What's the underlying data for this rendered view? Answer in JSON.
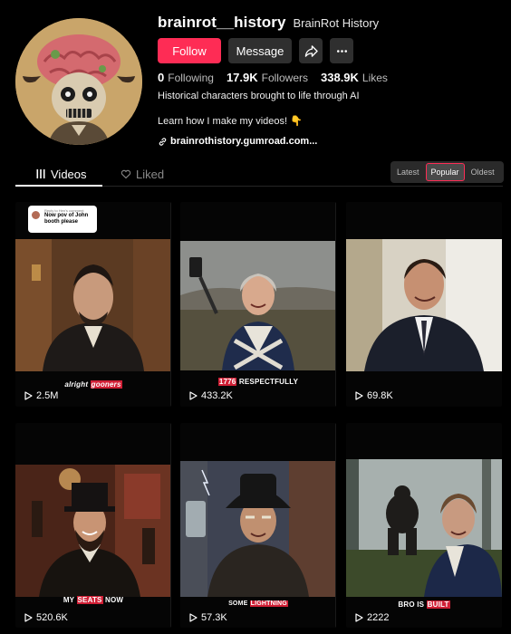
{
  "profile": {
    "username": "brainrot__history",
    "display_name": "BrainRot History",
    "follow_label": "Follow",
    "message_label": "Message",
    "share_icon": "share-icon",
    "more_icon": "more-icon",
    "stats": {
      "following_count": "0",
      "following_label": "Following",
      "followers_count": "17.9K",
      "followers_label": "Followers",
      "likes_count": "338.9K",
      "likes_label": "Likes"
    },
    "bio_line1": "Historical characters brought to life through AI",
    "bio_line2": "Learn how I make my videos!",
    "bio_emoji": "👇",
    "link": "brainrothistory.gumroad.com..."
  },
  "tabs": {
    "videos": "Videos",
    "liked": "Liked"
  },
  "sort": {
    "options": [
      "Latest",
      "Popular",
      "Oldest"
    ],
    "selected": "Popular"
  },
  "videos": [
    {
      "views": "2.5M",
      "caption_plain": "alright",
      "caption_hl": "gooners",
      "reply": {
        "meta": "Reply to Hen's comment",
        "text": "Now pov of John booth please"
      }
    },
    {
      "views": "433.2K",
      "caption_hl": "1776",
      "caption_plain": "RESPECTFULLY"
    },
    {
      "views": "69.8K"
    },
    {
      "views": "520.6K",
      "caption_plain": "MY",
      "caption_hl": "SEATS",
      "caption_plain2": "NOW"
    },
    {
      "views": "57.3K",
      "caption_plain": "SOME",
      "caption_hl": "LIGHTNING"
    },
    {
      "views": "2222",
      "caption_plain": "BRO IS",
      "caption_hl": "BUILT"
    }
  ],
  "colors": {
    "accent": "#fe2c55",
    "background": "#000000",
    "caption_highlight": "#d01f35"
  }
}
